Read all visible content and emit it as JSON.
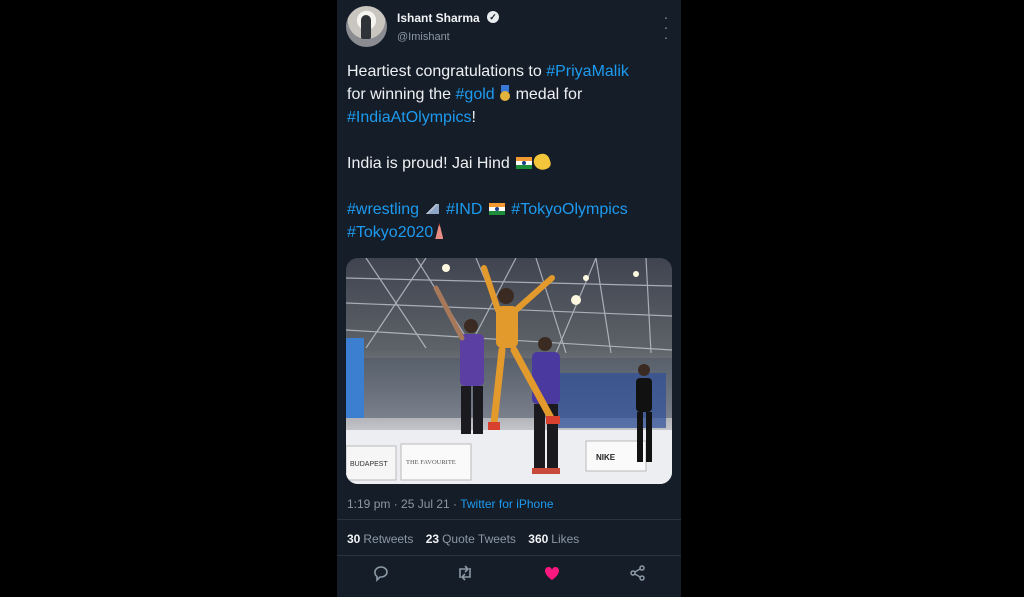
{
  "tweet": {
    "author_name": "Ishant Sharma",
    "handle": "@Imishant",
    "more_icon": "more-vertical-icon",
    "lines": [
      {
        "parts": [
          "Heartiest congratulations to ",
          "#PriyaMalik"
        ]
      },
      {
        "parts": [
          "for winning the ",
          "#gold",
          " medal for"
        ]
      },
      {
        "parts": [
          "#IndiaAtOlympics",
          "!"
        ]
      }
    ],
    "text": {
      "l1_plain": "Heartiest congratulations to ",
      "l1_tag": "#PriyaMalik",
      "l2_plain_a": "for winning the ",
      "l2_tag": "#gold",
      "l2_plain_b": " medal for",
      "l3_tag": "#IndiaAtOlympics",
      "l3_plain": "!",
      "l4_plain": "India is proud! Jai Hind ",
      "l5_tag_a": "#wrestling",
      "l5_tag_b": "#IND",
      "l5_tag_c": "#TokyoOlympics",
      "l6_tag": "#Tokyo2020"
    },
    "emojis": {
      "medal": "medal-icon",
      "flag": "india-flag-icon",
      "clap": "clapping-hands-icon",
      "mountain": "mountain-icon",
      "tower": "tokyo-tower-icon"
    },
    "timestamp": "1:19 pm · 25 Jul 21 · ",
    "source": "Twitter for iPhone",
    "stats": {
      "retweets_count": "30",
      "retweets_label": "Retweets",
      "quotes_count": "23",
      "quotes_label": "Quote Tweets",
      "likes_count": "360",
      "likes_label": "Likes"
    },
    "actions": [
      "reply-icon",
      "retweet-icon",
      "like-icon",
      "share-icon"
    ],
    "colors": {
      "background": "#151d28",
      "link": "#1d9bf0",
      "muted": "#8b98a5",
      "like": "#f91880"
    },
    "media": {
      "sign_left": "BUDAPEST",
      "sign_mid": "THE FAVOURITE",
      "sign_right": "NIKE"
    }
  }
}
